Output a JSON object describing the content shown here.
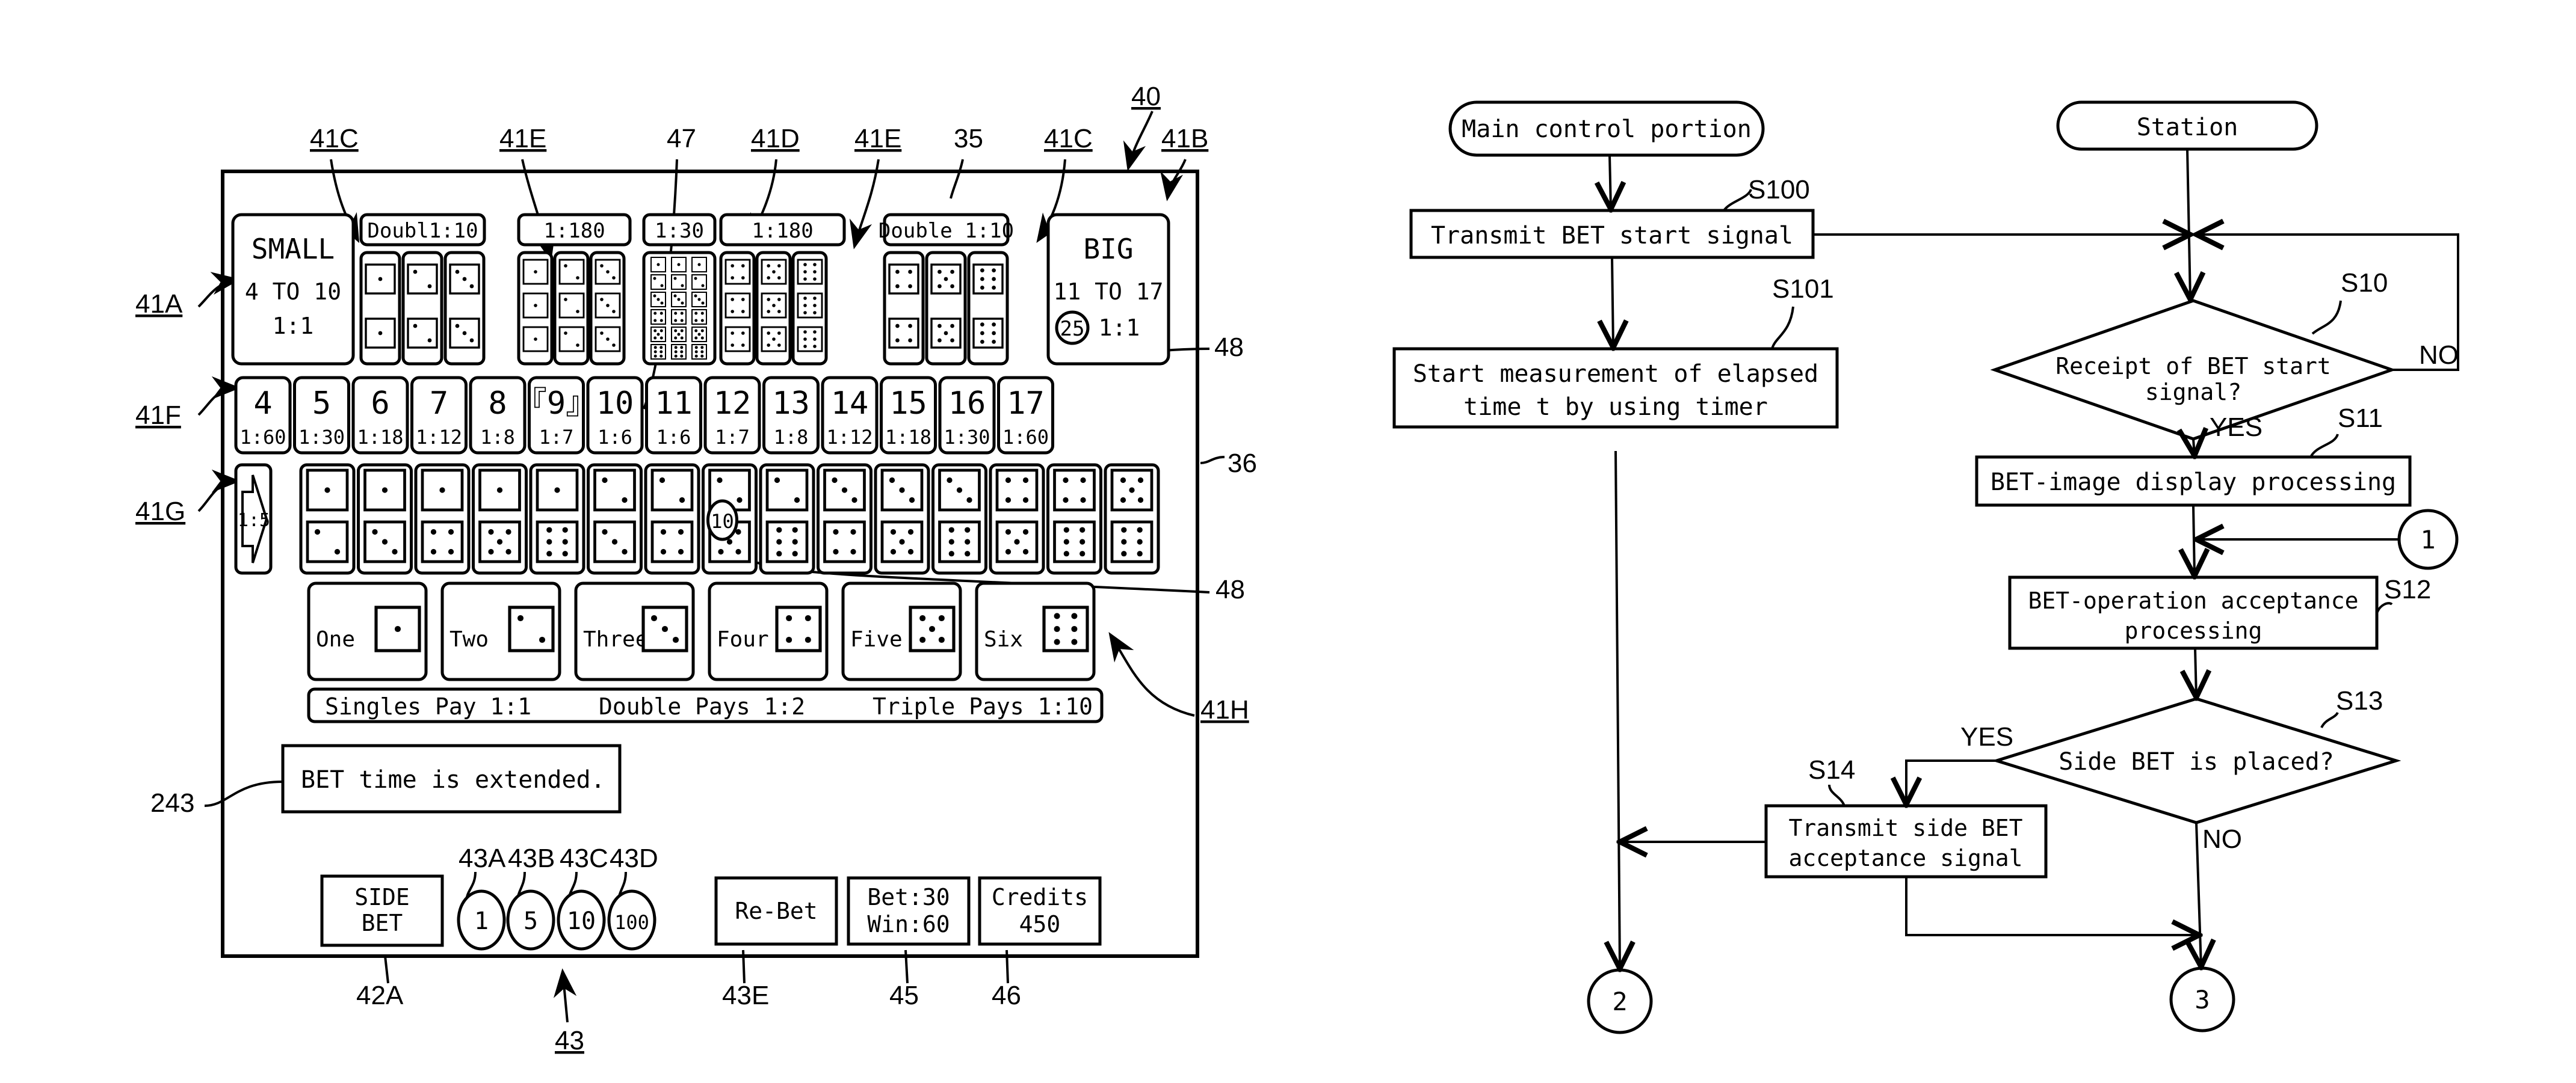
{
  "figure_left": {
    "ref_labels": {
      "r40": "40",
      "r41A": "41A",
      "r41B": "41B",
      "r41C_1": "41C",
      "r41C_2": "41C",
      "r41D": "41D",
      "r41E_1": "41E",
      "r41E_2": "41E",
      "r41F": "41F",
      "r41G": "41G",
      "r41H": "41H",
      "r47": "47",
      "r35": "35",
      "r36": "36",
      "r48_1": "48",
      "r48_2": "48",
      "r243": "243",
      "r42A": "42A",
      "r43": "43",
      "r43A": "43A",
      "r43B": "43B",
      "r43C": "43C",
      "r43D": "43D",
      "r43E": "43E",
      "r45": "45",
      "r46": "46"
    },
    "small": {
      "title": "SMALL",
      "range": "4 TO 10",
      "odds": "1:1"
    },
    "big": {
      "title": "BIG",
      "range": "11 TO 17",
      "odds": "1:1",
      "chip": "25"
    },
    "top_headers": [
      {
        "label": "Doubl1:10",
        "group": "41C"
      },
      {
        "label": "1:180",
        "group": "41E"
      },
      {
        "label": "1:30",
        "group": "41D"
      },
      {
        "label": "1:180",
        "group": "41E"
      },
      {
        "label": "Double 1:10",
        "group": "41C"
      }
    ],
    "doubles_left": [
      1,
      2,
      3
    ],
    "triples_left": [
      1,
      2,
      3
    ],
    "any_triple_faces": [
      1,
      2,
      3,
      4,
      5,
      6
    ],
    "triples_right": [
      4,
      5,
      6
    ],
    "doubles_right": [
      4,
      5,
      6
    ],
    "totals": [
      {
        "n": "4",
        "odds": "1:60"
      },
      {
        "n": "5",
        "odds": "1:30"
      },
      {
        "n": "6",
        "odds": "1:18"
      },
      {
        "n": "7",
        "odds": "1:12"
      },
      {
        "n": "8",
        "odds": "1:8"
      },
      {
        "n": "『9』",
        "odds": "1:7"
      },
      {
        "n": "10",
        "odds": "1:6"
      },
      {
        "n": "11",
        "odds": "1:6"
      },
      {
        "n": "12",
        "odds": "1:7"
      },
      {
        "n": "13",
        "odds": "1:8"
      },
      {
        "n": "14",
        "odds": "1:12"
      },
      {
        "n": "15",
        "odds": "1:18"
      },
      {
        "n": "16",
        "odds": "1:30"
      },
      {
        "n": "17",
        "odds": "1:60"
      }
    ],
    "combo_arrow_odds": "1:5",
    "combinations": [
      [
        1,
        2
      ],
      [
        1,
        3
      ],
      [
        1,
        4
      ],
      [
        1,
        5
      ],
      [
        1,
        6
      ],
      [
        2,
        3
      ],
      [
        2,
        4
      ],
      [
        2,
        5
      ],
      [
        2,
        6
      ],
      [
        3,
        4
      ],
      [
        3,
        5
      ],
      [
        3,
        6
      ],
      [
        4,
        5
      ],
      [
        4,
        6
      ],
      [
        5,
        6
      ]
    ],
    "combo_chip": "10",
    "singles": [
      {
        "label": "One",
        "face": 1
      },
      {
        "label": "Two",
        "face": 2
      },
      {
        "label": "Three",
        "face": 3
      },
      {
        "label": "Four",
        "face": 4
      },
      {
        "label": "Five",
        "face": 5
      },
      {
        "label": "Six",
        "face": 6
      }
    ],
    "pays_bar": {
      "singles": "Singles Pay 1:1",
      "double": "Double Pays 1:2",
      "triple": "Triple Pays 1:10"
    },
    "message": "BET time is extended.",
    "side_bet": {
      "line1": "SIDE",
      "line2": "BET"
    },
    "chips": [
      "1",
      "5",
      "10",
      "100"
    ],
    "rebet": "Re-Bet",
    "bet_win": {
      "bet": "Bet:30",
      "win": "Win:60"
    },
    "credits": {
      "label": "Credits",
      "value": "450"
    }
  },
  "figure_right": {
    "main_start": "Main control portion",
    "station_start": "Station",
    "s100": {
      "step": "S100",
      "text": "Transmit BET start signal"
    },
    "s101": {
      "step": "S101",
      "line1": "Start measurement of elapsed",
      "line2": "time t by using timer"
    },
    "s10": {
      "step": "S10",
      "line1": "Receipt of BET start",
      "line2": "signal?",
      "yes": "YES",
      "no": "NO"
    },
    "s11": {
      "step": "S11",
      "text": "BET-image display processing"
    },
    "s12": {
      "step": "S12",
      "line1": "BET-operation acceptance",
      "line2": "processing"
    },
    "s13": {
      "step": "S13",
      "text": "Side BET is placed?",
      "yes": "YES",
      "no": "NO"
    },
    "s14": {
      "step": "S14",
      "line1": "Transmit side BET",
      "line2": "acceptance signal"
    },
    "connectors": {
      "c1": "1",
      "c2": "2",
      "c3": "3"
    }
  }
}
